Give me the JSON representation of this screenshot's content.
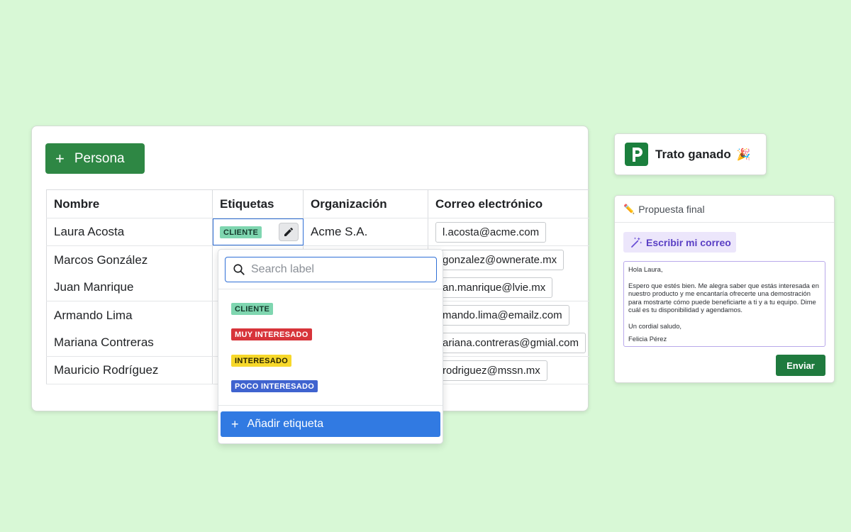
{
  "crm": {
    "add_button_label": "Persona",
    "columns": [
      "Nombre",
      "Etiquetas",
      "Organización",
      "Correo electrónico"
    ],
    "rows": [
      {
        "name": "Laura Acosta",
        "tag": "CLIENTE",
        "organization": "Acme S.A.",
        "email": "l.acosta@acme.com"
      },
      {
        "name": "Marcos González",
        "tag": "",
        "organization": "",
        "email": "gonzalez@ownerate.mx"
      },
      {
        "name": "Juan Manrique",
        "tag": "",
        "organization": "",
        "email": "an.manrique@lvie.mx"
      },
      {
        "name": "Armando Lima",
        "tag": "",
        "organization": "",
        "email": "mando.lima@emailz.com"
      },
      {
        "name": "Mariana Contreras",
        "tag": "",
        "organization": "",
        "email": "ariana.contreras@gmial.com"
      },
      {
        "name": "Mauricio Rodríguez",
        "tag": "",
        "organization": "",
        "email": "rodriguez@mssn.mx"
      }
    ]
  },
  "label_dropdown": {
    "search_placeholder": "Search label",
    "labels": [
      "CLIENTE",
      "MUY INTERESADO",
      "INTERESADO",
      "POCO INTERESADO"
    ],
    "add_label": "Añadir etiqueta"
  },
  "deal": {
    "text": "Trato ganado"
  },
  "proposal": {
    "title": "Propuesta final",
    "ai_button": "Escribir mi correo",
    "email_greeting": "Hola Laura,",
    "email_body": "Espero que estés bien. Me alegra saber que estás interesada en nuestro producto y me encantaría ofrecerte una demostración para mostrarte cómo puede beneficiarte a ti y a tu equipo. Dime cuál es tu disponibilidad y agendamos.",
    "email_closing": "Un cordial saludo,",
    "email_signature": "Felicia Pérez",
    "send_button": "Enviar"
  },
  "colors": {
    "page_bg": "#d8f8d6",
    "primary_green": "#2e8744",
    "accent_blue": "#317ae2",
    "tag_cliente": "#7fd6b0",
    "tag_muy_interesado": "#d7343a",
    "tag_interesado": "#f7d82a",
    "tag_poco_interesado": "#3f63cf",
    "ai_purple": "#5a3fc4"
  }
}
